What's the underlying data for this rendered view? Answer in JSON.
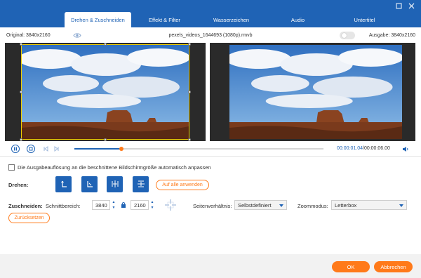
{
  "tabs": [
    {
      "label": "Drehen & Zuschneiden"
    },
    {
      "label": "Effekt & Filter"
    },
    {
      "label": "Wasserzeichen"
    },
    {
      "label": "Audio"
    },
    {
      "label": "Untertitel"
    }
  ],
  "window": {
    "min_icon": "minimize-icon",
    "close_icon": "close-icon"
  },
  "info": {
    "original": "Original: 3840x2160",
    "filename": "pexels_videos_1644693 (1080p).rmvb",
    "output": "Ausgabe: 3840x2160"
  },
  "playback": {
    "current": "00:00:01.04",
    "separator": "/",
    "total": "00:00:06.00",
    "progress": 0.19
  },
  "auto_resize_label": "Die Ausgabeauflösung an die beschnittene Bildschirmgröße automatisch anpassen",
  "rotate": {
    "label": "Drehen:",
    "apply_all": "Auf alle anwenden"
  },
  "crop": {
    "label": "Zuschneiden:",
    "area_label": "Schnittbereich:",
    "width": "3840",
    "height": "2160",
    "aspect_label": "Seitenverhältnis:",
    "aspect_value": "Selbstdefiniert",
    "zoom_label": "Zoommodus:",
    "zoom_value": "Letterbox",
    "reset": "Zurücksetzen"
  },
  "footer": {
    "ok": "OK",
    "cancel": "Abbrechen"
  },
  "colors": {
    "accent": "#1f63b5",
    "orange": "#ff7a1a",
    "crop_frame": "#f0d000"
  }
}
